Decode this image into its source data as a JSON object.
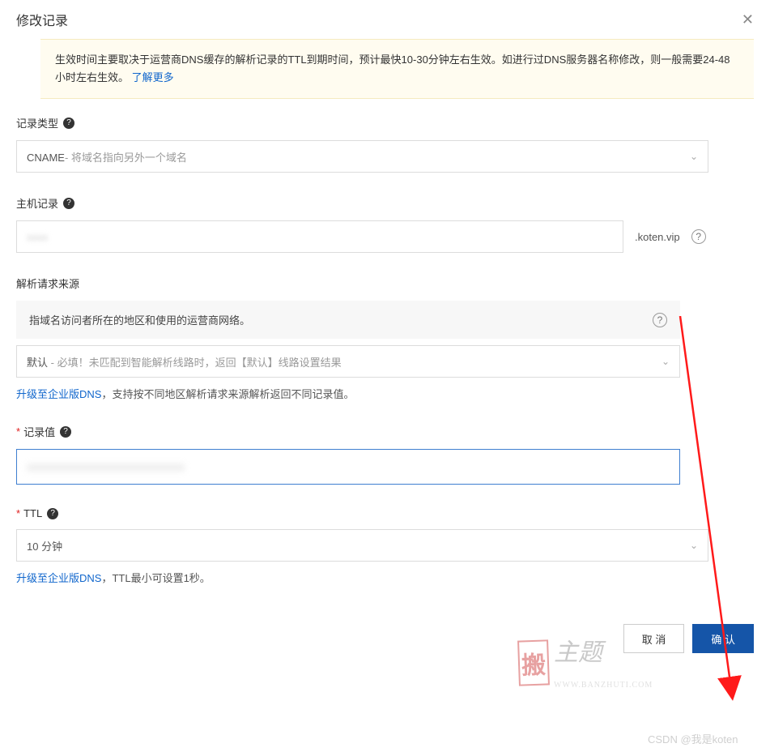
{
  "header": {
    "title": "修改记录"
  },
  "notice": {
    "text": "生效时间主要取决于运营商DNS缓存的解析记录的TTL到期时间，预计最快10-30分钟左右生效。如进行过DNS服务器名称修改，则一般需要24-48小时左右生效。",
    "link": "了解更多"
  },
  "record_type": {
    "label": "记录类型",
    "value_prefix": "CNAME",
    "value_desc": "- 将域名指向另外一个域名"
  },
  "host": {
    "label": "主机记录",
    "suffix": ".koten.vip"
  },
  "source": {
    "label": "解析请求来源",
    "info": "指域名访问者所在的地区和使用的运营商网络。",
    "placeholder_prefix": "默认",
    "placeholder_desc": " - 必填！未匹配到智能解析线路时，返回【默认】线路设置结果",
    "hint_link": "升级至企业版DNS",
    "hint_rest": "，支持按不同地区解析请求来源解析返回不同记录值。"
  },
  "record_value": {
    "label": "记录值"
  },
  "ttl": {
    "label": "TTL",
    "value": "10 分钟",
    "hint_link": "升级至企业版DNS",
    "hint_rest": "，TTL最小可设置1秒。"
  },
  "footer": {
    "cancel": "取 消",
    "confirm": "确 认"
  },
  "watermark": {
    "seal": "搬",
    "title": "主题",
    "sub": "WWW.BANZHUTI.COM",
    "csdn": "CSDN @我是koten"
  }
}
